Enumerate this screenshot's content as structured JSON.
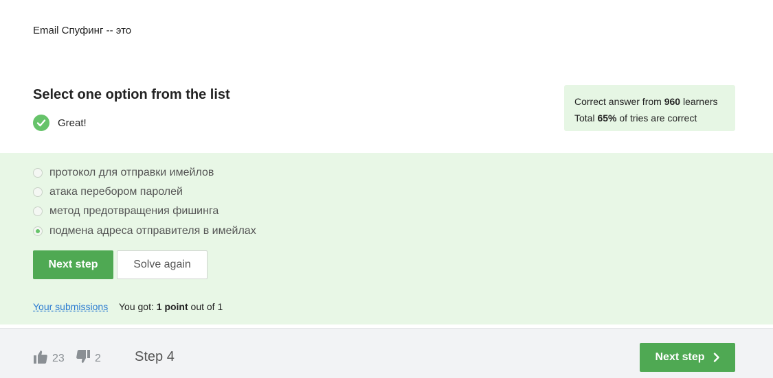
{
  "question": {
    "text": "Email Спуфинг -- это"
  },
  "instructions": {
    "title": "Select one option from the list"
  },
  "feedback": {
    "label": "Great!"
  },
  "stats": {
    "line1_prefix": "Correct answer from ",
    "learners_count": "960",
    "line1_suffix": " learners",
    "line2_prefix": "Total ",
    "correct_percent": "65%",
    "line2_suffix": " of tries are correct"
  },
  "options": [
    {
      "label": "протокол для отправки имейлов",
      "selected": false
    },
    {
      "label": "атака перебором паролей",
      "selected": false
    },
    {
      "label": "метод предотвращения фишинга",
      "selected": false
    },
    {
      "label": "подмена адреса отправителя в имейлах",
      "selected": true
    }
  ],
  "actions": {
    "next_step_label": "Next step",
    "solve_again_label": "Solve again"
  },
  "submission": {
    "link_label": "Your submissions",
    "result_prefix": "You got: ",
    "result_points": "1 point",
    "result_suffix": " out of 1"
  },
  "footer": {
    "likes": "23",
    "dislikes": "2",
    "step_label": "Step 4",
    "next_step_label": "Next step"
  },
  "colors": {
    "accent": "#4fa953",
    "success_bg": "#e8f7e6",
    "link": "#2b7bd1"
  },
  "icons": {
    "check": "check-circle-icon",
    "like": "thumbs-up-icon",
    "dislike": "thumbs-down-icon",
    "next": "chevron-right-icon"
  }
}
